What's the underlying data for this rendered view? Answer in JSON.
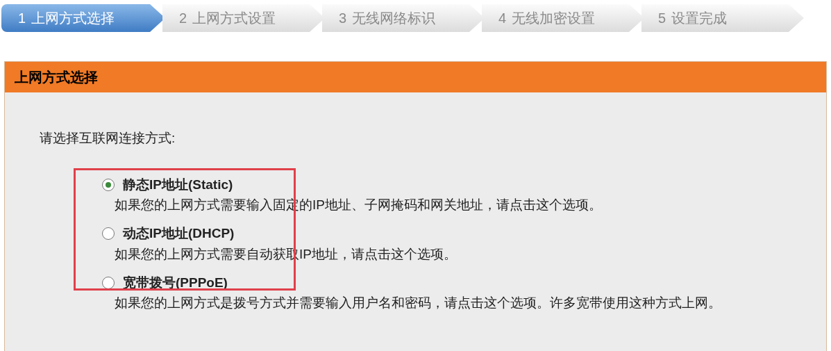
{
  "steps": [
    {
      "number": "1",
      "label": "上网方式选择",
      "selected": true
    },
    {
      "number": "2",
      "label": "上网方式设置",
      "selected": false
    },
    {
      "number": "3",
      "label": "无线网络标识",
      "selected": false
    },
    {
      "number": "4",
      "label": "无线加密设置",
      "selected": false
    },
    {
      "number": "5",
      "label": "设置完成",
      "selected": false
    }
  ],
  "panel": {
    "title": "上网方式选择",
    "prompt": "请选择互联网连接方式:",
    "options": [
      {
        "label": "静态IP地址(Static)",
        "description": "如果您的上网方式需要输入固定的IP地址、子网掩码和网关地址，请点击这个选项。",
        "selected": true
      },
      {
        "label": "动态IP地址(DHCP)",
        "description": "如果您的上网方式需要自动获取IP地址，请点击这个选项。",
        "selected": false
      },
      {
        "label": "宽带拨号(PPPoE)",
        "description": "如果您的上网方式是拨号方式并需要输入用户名和密码，请点击这个选项。许多宽带使用这种方式上网。",
        "selected": false
      }
    ]
  }
}
